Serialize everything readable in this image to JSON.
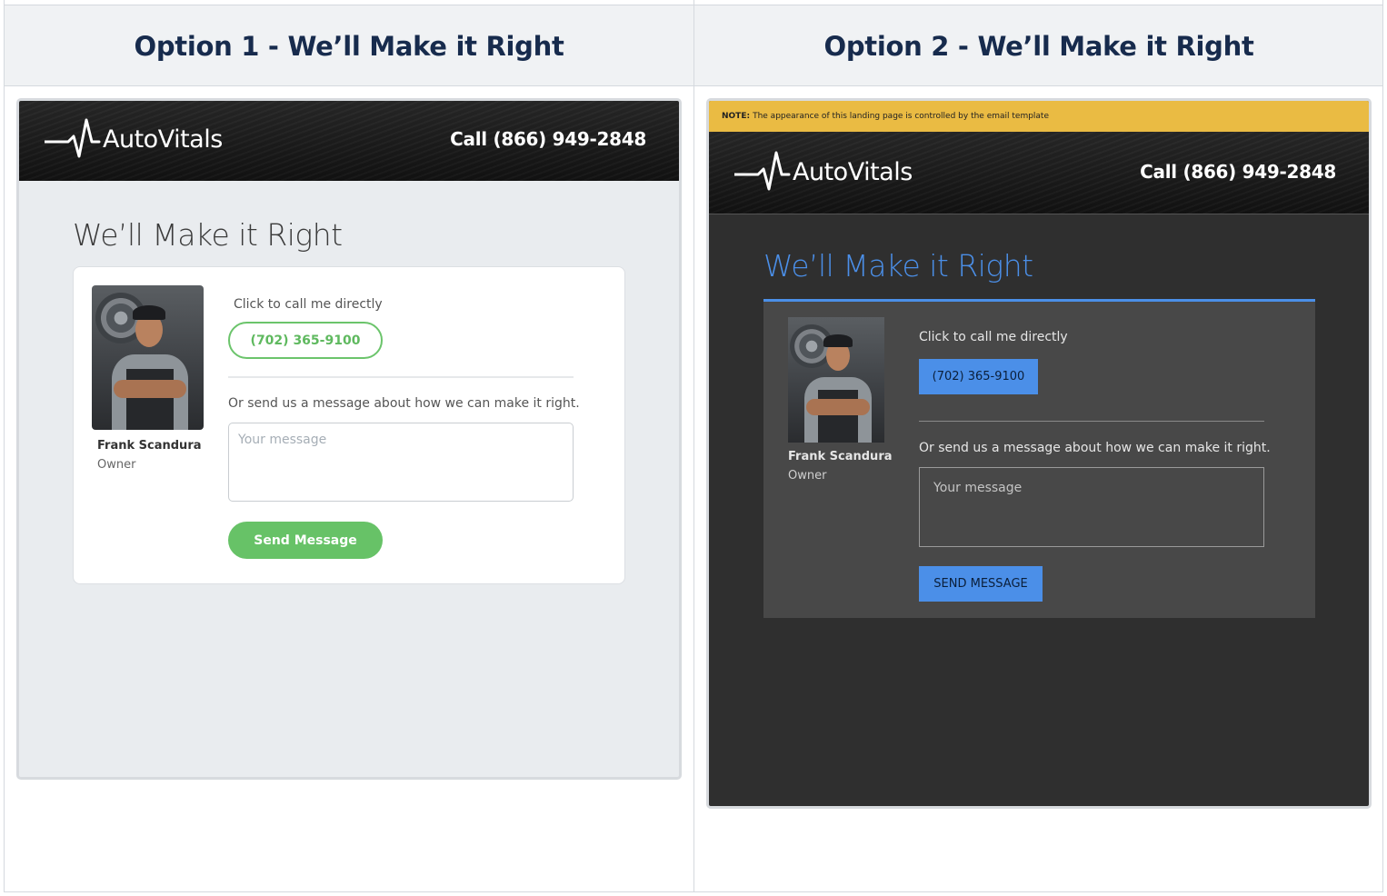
{
  "columns": [
    {
      "header": "Option 1 - We’ll Make it Right"
    },
    {
      "header": "Option 2 - We’ll Make it Right"
    }
  ],
  "brand": {
    "logo_text": "AutoVitals",
    "call_text": "Call (866) 949-2848"
  },
  "option1": {
    "page_title": "We’ll Make it Right",
    "contact_name": "Frank Scandura",
    "contact_role": "Owner",
    "call_prompt": "Click to call me directly",
    "phone": "(702) 365-9100",
    "message_prompt": "Or send us a message about how we can make it right.",
    "message_placeholder": "Your message",
    "send_label": "Send Message",
    "accent_color": "#67c267"
  },
  "option2": {
    "note_label": "NOTE:",
    "note_text": "The appearance of this landing page is controlled by the email template",
    "page_title": "We’ll Make it Right",
    "contact_name": "Frank Scandura",
    "contact_role": "Owner",
    "call_prompt": "Click to call me directly",
    "phone": "(702) 365-9100",
    "message_prompt": "Or send us a message about how we can make it right.",
    "message_placeholder": "Your message",
    "send_label": "SEND MESSAGE",
    "accent_color": "#4b8fe8",
    "note_color": "#eabb43"
  },
  "icons": {
    "logo": "heartbeat-pulse-icon",
    "photo": "mechanic-portrait"
  }
}
